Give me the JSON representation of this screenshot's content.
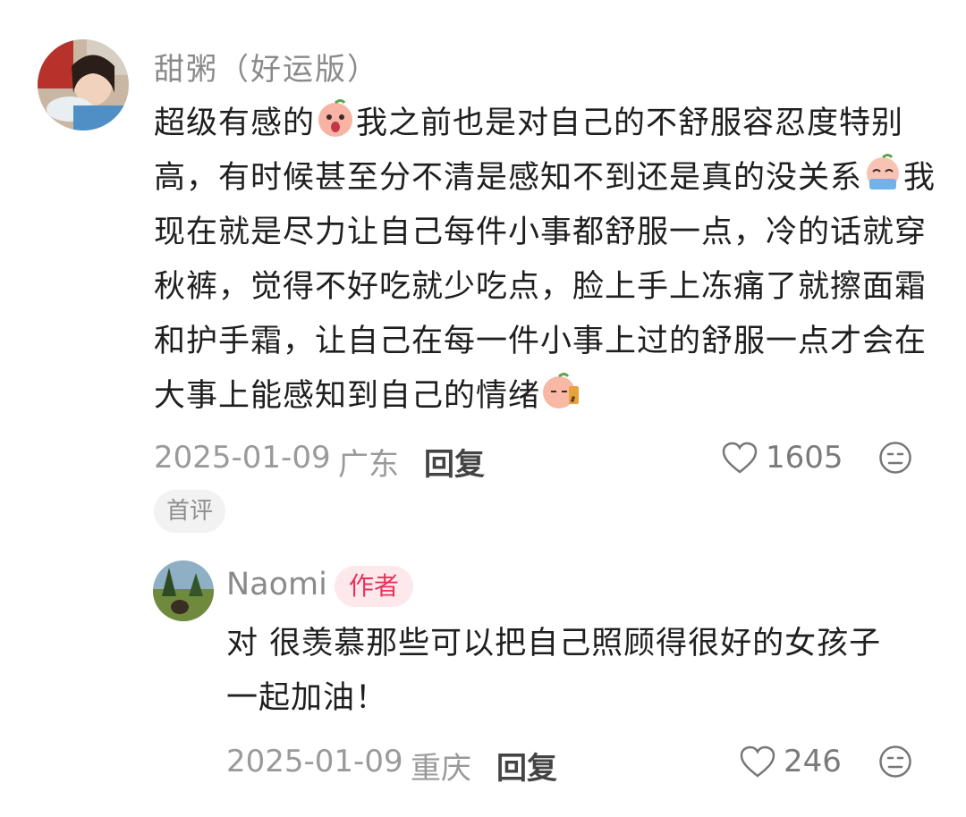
{
  "comment": {
    "username": "甜粥（好运版）",
    "text_parts": [
      "超级有感的",
      "我之前也是对自己的不舒服容忍度特别高，有时候甚至分不清是感知不到还是真的没关系",
      "我现在就是尽力让自己每件小事都舒服一点，冷的话就穿秋裤，觉得不好吃就少吃点，脸上手上冻痛了就擦面霜和护手霜，让自己在每一件小事上过的舒服一点才会在大事上能感知到自己的情绪"
    ],
    "date": "2025-01-09",
    "location": "广东",
    "reply_label": "回复",
    "likes": "1605",
    "badge": "首评"
  },
  "reply": {
    "username": "Naomi",
    "author_tag": "作者",
    "text": "对 很羡慕那些可以把自己照顾得很好的女孩子 一起加油！",
    "date": "2025-01-09",
    "location": "重庆",
    "reply_label": "回复",
    "likes": "246"
  },
  "icons": {
    "like": "heart-outline-icon",
    "dislike": "neutral-face-icon",
    "emoji_1": "peach-shocked-emoji",
    "emoji_2": "peach-crying-emoji",
    "emoji_3": "peach-drink-emoji"
  },
  "colors": {
    "author_tag_text": "#e8335a",
    "author_tag_bg": "#fde8ec",
    "meta_text": "#9a9a9a"
  }
}
